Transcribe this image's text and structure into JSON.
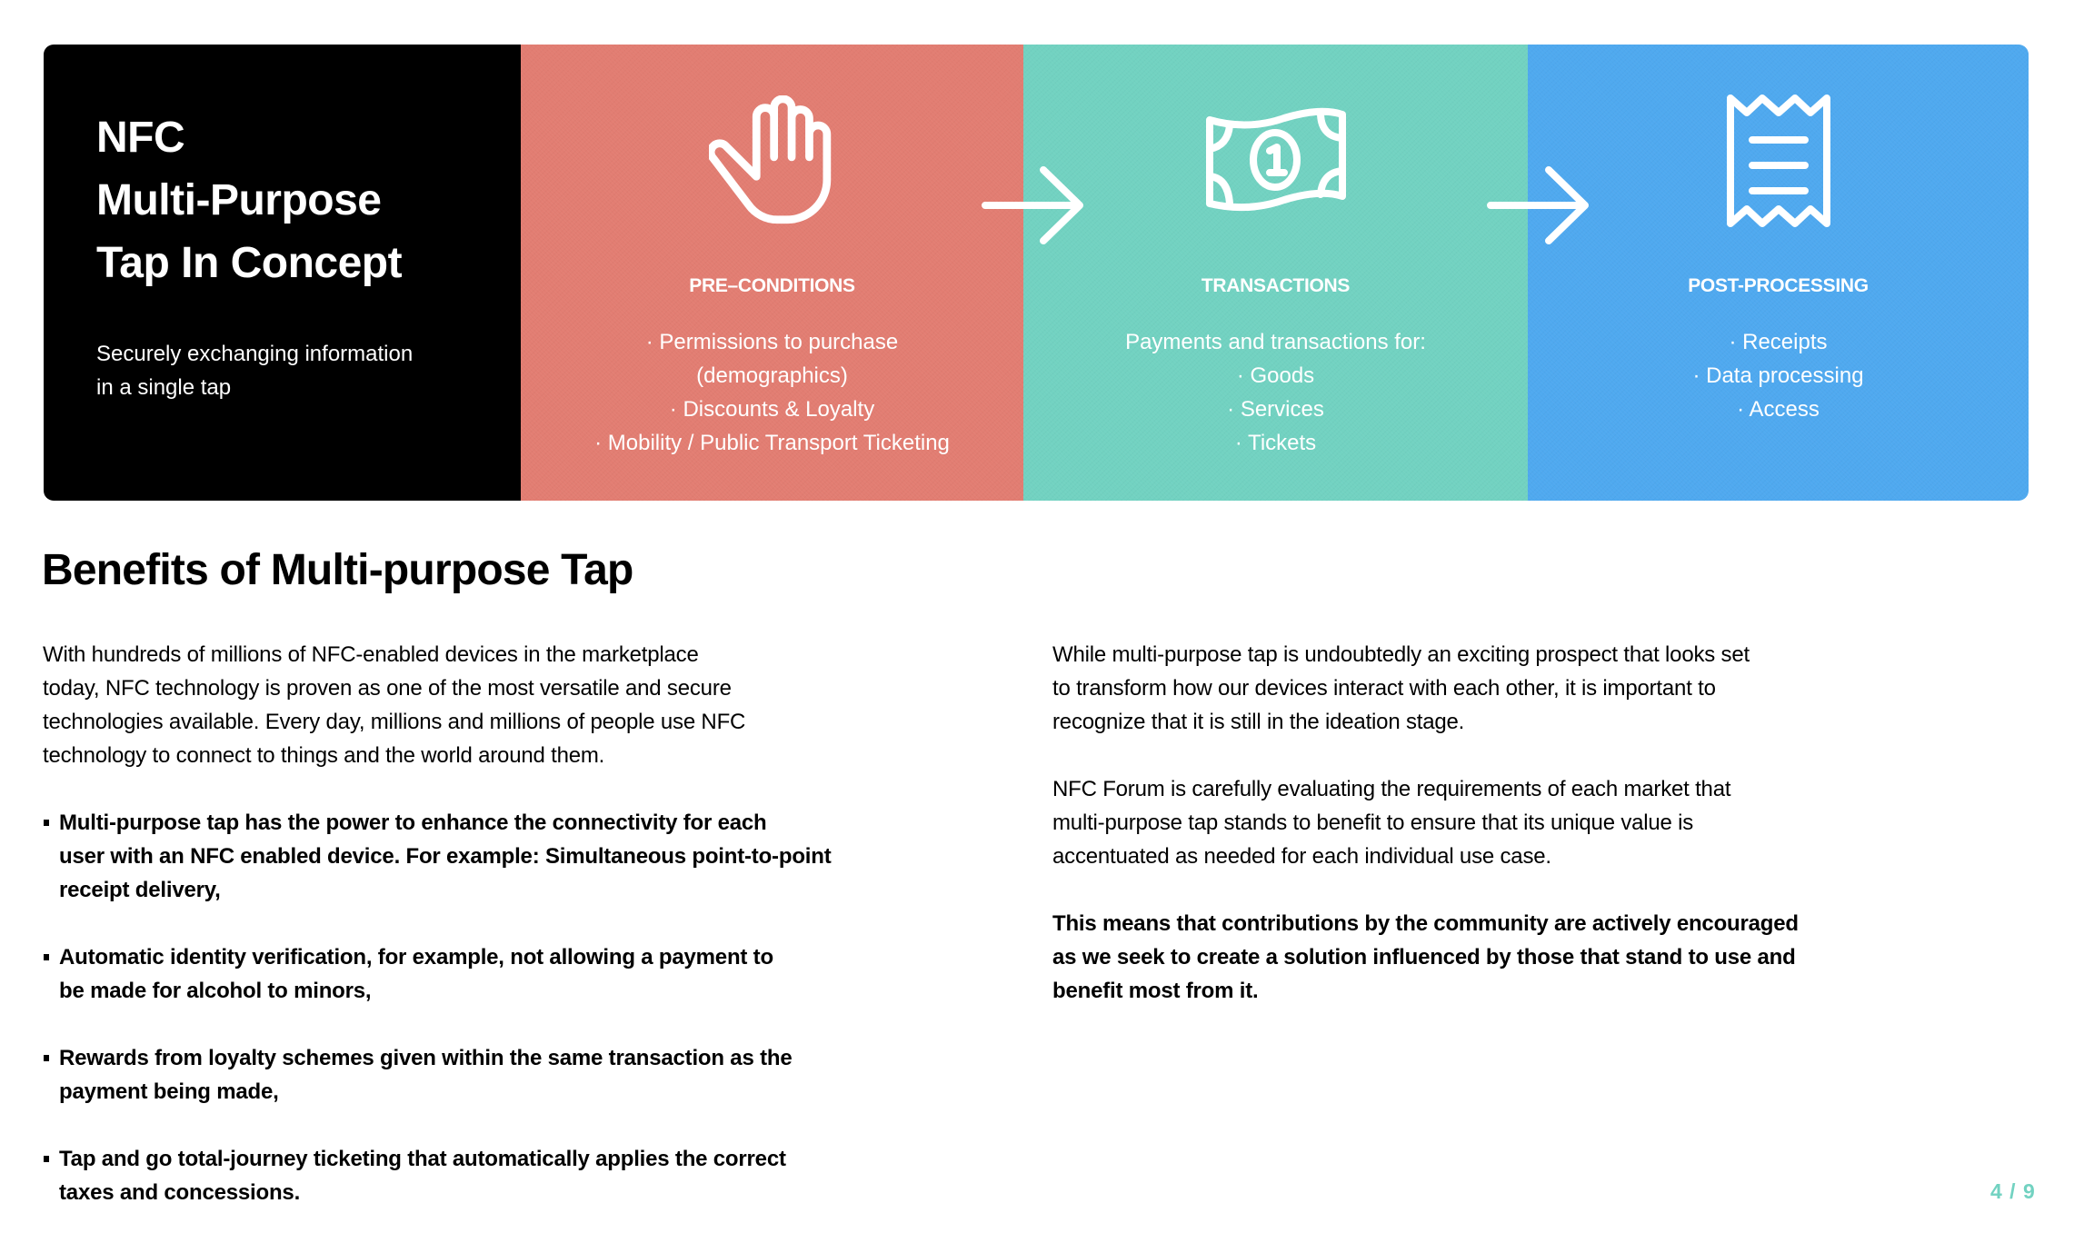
{
  "colors": {
    "intro_bg": "#000000",
    "pre_conditions": "#E27D72",
    "transactions": "#72D2C1",
    "post_processing": "#4FA9EF",
    "page_number": "#72D2C1"
  },
  "hero": {
    "title_lines": [
      "NFC",
      "Multi-Purpose",
      "Tap In Concept"
    ],
    "subtitle_lines": [
      "Securely exchanging information",
      "in a single tap"
    ],
    "stages": [
      {
        "icon": "hand-icon",
        "title": "PRE–CONDITIONS",
        "lines": [
          "· Permissions to purchase",
          "(demographics)",
          "· Discounts & Loyalty",
          "· Mobility / Public Transport Ticketing"
        ]
      },
      {
        "icon": "banknote-icon",
        "title": "TRANSACTIONS",
        "lines": [
          "Payments and transactions for:",
          "· Goods",
          "· Services",
          "· Tickets"
        ]
      },
      {
        "icon": "receipt-icon",
        "title": "POST-PROCESSING",
        "lines": [
          "· Receipts",
          "· Data processing",
          "· Access"
        ]
      }
    ],
    "arrows": [
      "arrow-right-icon",
      "arrow-right-icon"
    ]
  },
  "benefits": {
    "heading": "Benefits of Multi-purpose Tap",
    "intro_lines": [
      "With hundreds of millions of NFC-enabled devices in the marketplace",
      "today, NFC technology is proven as one of the most versatile and secure",
      "technologies available. Every day, millions and millions of people use NFC",
      "technology to connect to things and the world around them."
    ],
    "bullets": [
      [
        "Multi-purpose tap has the power to enhance the connectivity for each",
        "user with an NFC enabled device. For example: Simultaneous point-to-point",
        "receipt delivery,"
      ],
      [
        "Automatic identity verification, for example, not allowing a payment to",
        "be made for alcohol to minors,"
      ],
      [
        "Rewards from loyalty schemes given within the same transaction as the",
        "payment being made,"
      ],
      [
        "Tap and go total-journey ticketing that automatically applies the correct",
        "taxes and concessions."
      ]
    ],
    "right_paragraphs": [
      [
        "While multi-purpose tap is undoubtedly an exciting prospect that looks set",
        "to transform how our devices interact with each other, it is important to",
        "recognize that it is still in the ideation stage."
      ],
      [
        "NFC Forum is carefully evaluating the requirements of each market that",
        "multi-purpose tap stands to benefit to ensure that its unique value is",
        "accentuated as needed for each individual use case."
      ],
      [
        "This means that contributions by the community are actively encouraged",
        "as we seek to create a solution influenced by those that stand to use and",
        "benefit most from it."
      ]
    ]
  },
  "page_number": "4 / 9"
}
